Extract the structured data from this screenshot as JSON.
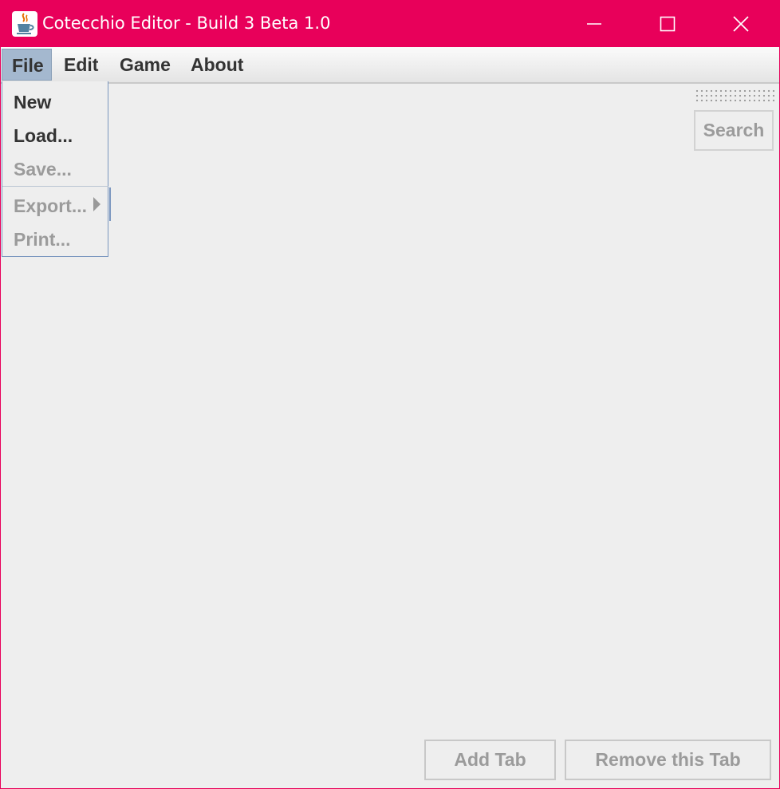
{
  "window": {
    "title": "Cotecchio Editor - Build 3 Beta 1.0",
    "accent_color": "#e8005a",
    "icon": "java-coffee-cup-icon"
  },
  "menubar": {
    "items": [
      "File",
      "Edit",
      "Game",
      "About"
    ],
    "active": "File"
  },
  "file_menu": {
    "items": [
      {
        "label": "New",
        "enabled": true
      },
      {
        "label": "Load...",
        "enabled": true
      },
      {
        "label": "Save...",
        "enabled": false
      },
      {
        "label": "Export...",
        "enabled": false,
        "submenu": true
      },
      {
        "label": "Print...",
        "enabled": false
      }
    ]
  },
  "toolbar": {
    "search_label": "Search"
  },
  "footer": {
    "add_tab_label": "Add Tab",
    "remove_tab_label": "Remove this Tab"
  }
}
